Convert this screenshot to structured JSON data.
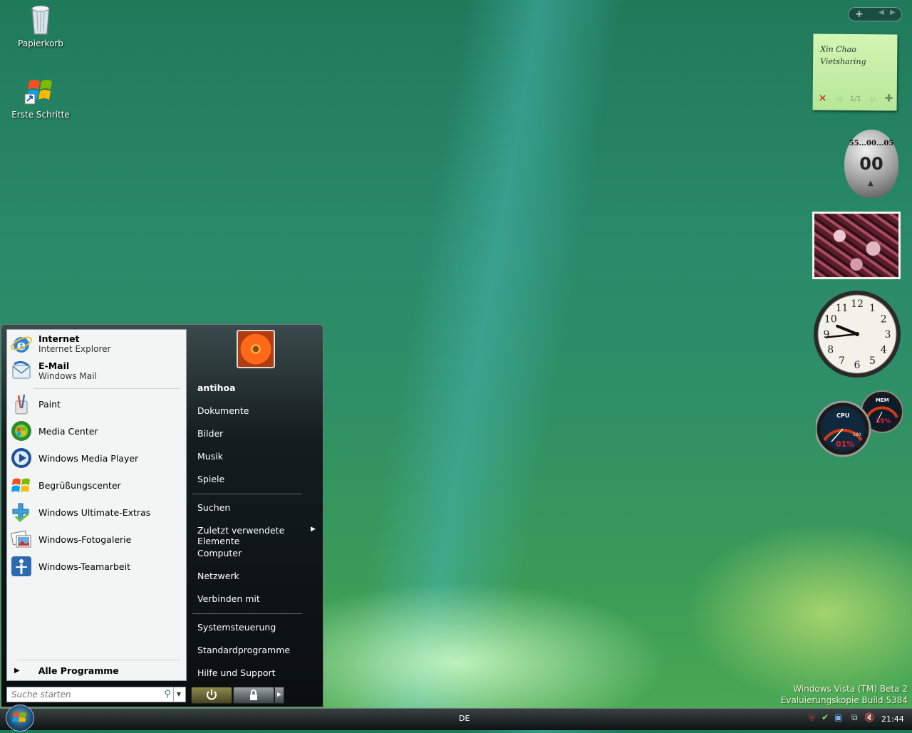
{
  "desktop": {
    "icons": [
      {
        "label": "Papierkorb",
        "icon": "recycle-bin-icon"
      },
      {
        "label": "Erste Schritte",
        "icon": "windows-logo-icon"
      }
    ]
  },
  "start_menu": {
    "pinned": [
      {
        "title": "Internet",
        "subtitle": "Internet Explorer",
        "icon": "internet-explorer-icon"
      },
      {
        "title": "E-Mail",
        "subtitle": "Windows Mail",
        "icon": "windows-mail-icon"
      }
    ],
    "recent": [
      {
        "label": "Paint",
        "icon": "paint-icon"
      },
      {
        "label": "Media Center",
        "icon": "media-center-icon"
      },
      {
        "label": "Windows Media Player",
        "icon": "media-player-icon"
      },
      {
        "label": "Begrüßungscenter",
        "icon": "welcome-center-icon"
      },
      {
        "label": "Windows Ultimate-Extras",
        "icon": "ultimate-extras-icon"
      },
      {
        "label": "Windows-Fotogalerie",
        "icon": "photo-gallery-icon"
      },
      {
        "label": "Windows-Teamarbeit",
        "icon": "meeting-space-icon"
      }
    ],
    "all_programs": "Alle Programme",
    "search_placeholder": "Suche starten",
    "right": {
      "user": "antihoa",
      "group1": [
        "Dokumente",
        "Bilder",
        "Musik",
        "Spiele"
      ],
      "group2": [
        "Suchen",
        "Zuletzt verwendete Elemente",
        "Computer",
        "Netzwerk",
        "Verbinden mit"
      ],
      "group3": [
        "Systemsteuerung",
        "Standardprogramme",
        "Hilfe und Support"
      ]
    }
  },
  "taskbar": {
    "language": "DE",
    "time": "21:44"
  },
  "watermark": {
    "line1": "Windows Vista (TM) Beta 2",
    "line2": "Evaluierungskopie Build 5384"
  },
  "gadgets": {
    "note": {
      "line1": "Xin Chao",
      "line2": "Vietsharing",
      "page": "1/1"
    },
    "timer": {
      "scale": "55...00...05",
      "value": "00"
    },
    "clock": {
      "hour": 9,
      "minute": 44
    },
    "meter": {
      "cpu_label": "CPU",
      "cpu_value": "01%",
      "mem_label": "MEM",
      "mem_value": "35%",
      "scale_max": "100"
    }
  },
  "colors": {
    "accent": "#1d4a6e",
    "note": "#c6f0a6"
  }
}
